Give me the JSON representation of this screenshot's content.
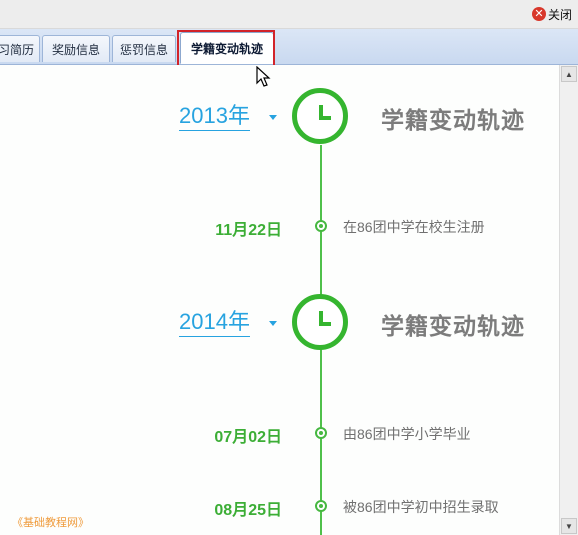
{
  "window": {
    "close_label": "关闭",
    "close_icon": "close-icon"
  },
  "tabs": [
    {
      "label": "习简历",
      "active": false
    },
    {
      "label": "奖励信息",
      "active": false
    },
    {
      "label": "惩罚信息",
      "active": false
    },
    {
      "label": "学籍变动轨迹",
      "active": true
    }
  ],
  "timeline": {
    "sections": [
      {
        "year": "2013年",
        "title": "学籍变动轨迹",
        "events": [
          {
            "date": "11月22日",
            "text": "在86团中学在校生注册"
          }
        ]
      },
      {
        "year": "2014年",
        "title": "学籍变动轨迹",
        "events": [
          {
            "date": "07月02日",
            "text": "由86团中学小学毕业"
          },
          {
            "date": "08月25日",
            "text": "被86团中学初中招生录取"
          }
        ]
      }
    ]
  },
  "watermark": "《基础教程网》",
  "colors": {
    "accent_green": "#35b52f",
    "year_blue": "#27a3e0",
    "highlight_red": "#d2232a"
  }
}
